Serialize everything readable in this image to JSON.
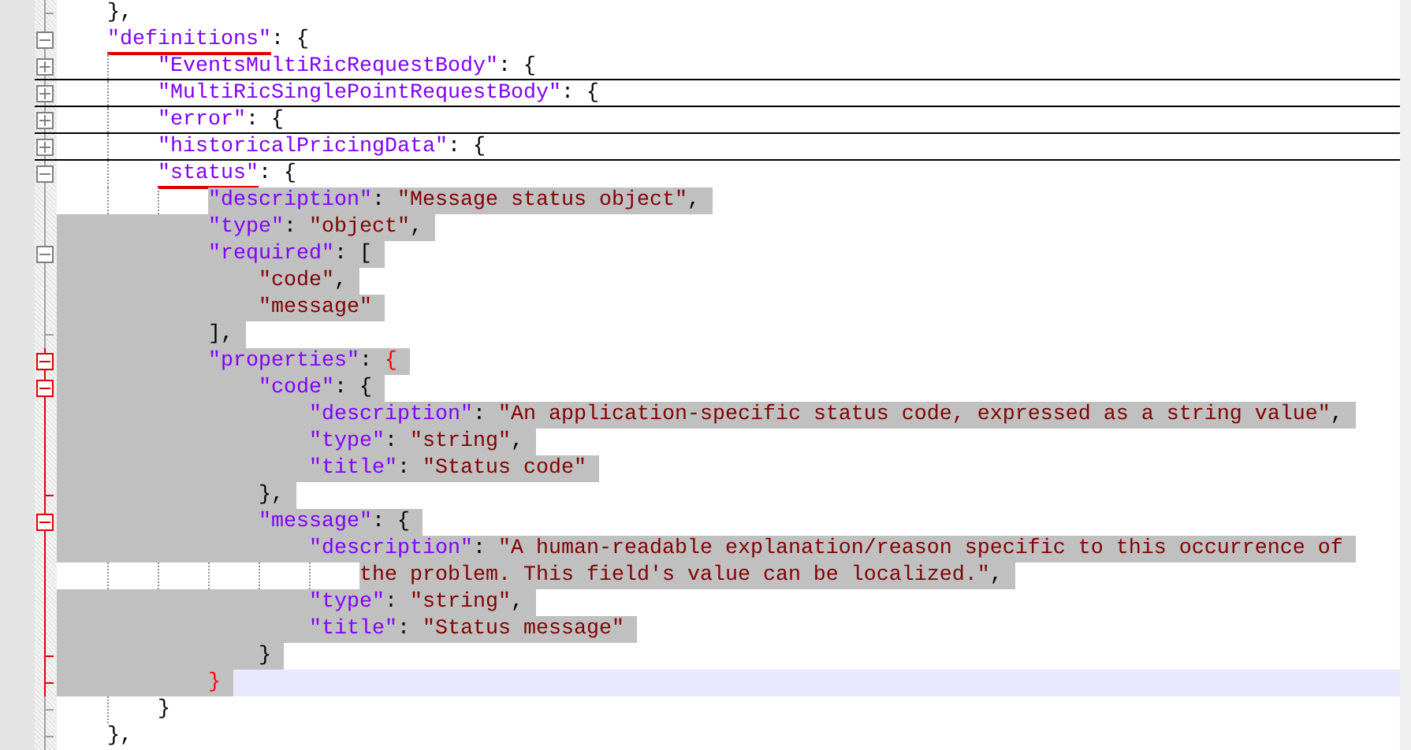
{
  "editor": {
    "lines": [
      {
        "kind": "close",
        "tokens": [
          {
            "kind": "punct",
            "text": "},"
          }
        ]
      },
      {
        "kind": "open",
        "expanded": true,
        "tokens": [
          {
            "kind": "key",
            "text": "\"definitions\"",
            "underlined": true
          },
          {
            "kind": "punct",
            "text": ": {"
          }
        ],
        "children": [
          {
            "kind": "open",
            "expanded": false,
            "tokens": [
              {
                "kind": "key",
                "text": "\"EventsMultiRicRequestBody\""
              },
              {
                "kind": "punct",
                "text": ": {"
              }
            ]
          },
          {
            "kind": "open",
            "expanded": false,
            "tokens": [
              {
                "kind": "key",
                "text": "\"MultiRicSinglePointRequestBody\""
              },
              {
                "kind": "punct",
                "text": ": {"
              }
            ]
          },
          {
            "kind": "open",
            "expanded": false,
            "tokens": [
              {
                "kind": "key",
                "text": "\"error\""
              },
              {
                "kind": "punct",
                "text": ": {"
              }
            ]
          },
          {
            "kind": "open",
            "expanded": false,
            "tokens": [
              {
                "kind": "key",
                "text": "\"historicalPricingData\""
              },
              {
                "kind": "punct",
                "text": ": {"
              }
            ]
          },
          {
            "kind": "open",
            "expanded": true,
            "tokens": [
              {
                "kind": "key",
                "text": "\"status\"",
                "underlined": true
              },
              {
                "kind": "punct",
                "text": ": {"
              }
            ],
            "children": [
              {
                "kind": "line",
                "selected": true,
                "tokens": [
                  {
                    "kind": "key",
                    "text": "\"description\""
                  },
                  {
                    "kind": "punct",
                    "text": ": "
                  },
                  {
                    "kind": "string",
                    "text": "\"Message status object\""
                  },
                  {
                    "kind": "punct",
                    "text": ","
                  }
                ]
              },
              {
                "kind": "line",
                "selected": true,
                "tokens": [
                  {
                    "kind": "key",
                    "text": "\"type\""
                  },
                  {
                    "kind": "punct",
                    "text": ": "
                  },
                  {
                    "kind": "string",
                    "text": "\"object\""
                  },
                  {
                    "kind": "punct",
                    "text": ","
                  }
                ]
              },
              {
                "kind": "open",
                "expanded": true,
                "selected": true,
                "tokens": [
                  {
                    "kind": "key",
                    "text": "\"required\""
                  },
                  {
                    "kind": "punct",
                    "text": ": ["
                  }
                ],
                "children": [
                  {
                    "kind": "line",
                    "selected": true,
                    "tokens": [
                      {
                        "kind": "string",
                        "text": "\"code\""
                      },
                      {
                        "kind": "punct",
                        "text": ","
                      }
                    ]
                  },
                  {
                    "kind": "line",
                    "selected": true,
                    "tokens": [
                      {
                        "kind": "string",
                        "text": "\"message\""
                      }
                    ]
                  }
                ]
              },
              {
                "kind": "close",
                "selected": true,
                "tokens": [
                  {
                    "kind": "punct",
                    "text": "],"
                  }
                ]
              },
              {
                "kind": "open",
                "expanded": true,
                "highlighted": true,
                "selected": true,
                "tokens": [
                  {
                    "kind": "key",
                    "text": "\"properties\""
                  },
                  {
                    "kind": "punct",
                    "text": ": "
                  },
                  {
                    "kind": "brace-match",
                    "text": "{"
                  }
                ],
                "children": [
                  {
                    "kind": "open",
                    "expanded": true,
                    "selected": true,
                    "tokens": [
                      {
                        "kind": "key",
                        "text": "\"code\""
                      },
                      {
                        "kind": "punct",
                        "text": ": {"
                      }
                    ],
                    "children": [
                      {
                        "kind": "line",
                        "selected": true,
                        "tokens": [
                          {
                            "kind": "key",
                            "text": "\"description\""
                          },
                          {
                            "kind": "punct",
                            "text": ": "
                          },
                          {
                            "kind": "string",
                            "text": "\"An application-specific status code, expressed as a string value\""
                          },
                          {
                            "kind": "punct",
                            "text": ","
                          }
                        ]
                      },
                      {
                        "kind": "line",
                        "selected": true,
                        "tokens": [
                          {
                            "kind": "key",
                            "text": "\"type\""
                          },
                          {
                            "kind": "punct",
                            "text": ": "
                          },
                          {
                            "kind": "string",
                            "text": "\"string\""
                          },
                          {
                            "kind": "punct",
                            "text": ","
                          }
                        ]
                      },
                      {
                        "kind": "line",
                        "selected": true,
                        "tokens": [
                          {
                            "kind": "key",
                            "text": "\"title\""
                          },
                          {
                            "kind": "punct",
                            "text": ": "
                          },
                          {
                            "kind": "string",
                            "text": "\"Status code\""
                          }
                        ]
                      }
                    ]
                  },
                  {
                    "kind": "close",
                    "selected": true,
                    "tokens": [
                      {
                        "kind": "punct",
                        "text": "},"
                      }
                    ]
                  },
                  {
                    "kind": "open",
                    "expanded": true,
                    "selected": true,
                    "tokens": [
                      {
                        "kind": "key",
                        "text": "\"message\""
                      },
                      {
                        "kind": "punct",
                        "text": ": {"
                      }
                    ],
                    "children": [
                      {
                        "kind": "line",
                        "selected": true,
                        "tokens": [
                          {
                            "kind": "key",
                            "text": "\"description\""
                          },
                          {
                            "kind": "punct",
                            "text": ": "
                          },
                          {
                            "kind": "string",
                            "text": "\"A human-readable explanation/reason specific to this occurrence of"
                          }
                        ],
                        "continuation": [
                          {
                            "kind": "string",
                            "text": "the problem. This field's value can be localized.\""
                          },
                          {
                            "kind": "punct",
                            "text": ","
                          }
                        ]
                      },
                      {
                        "kind": "line",
                        "selected": true,
                        "tokens": [
                          {
                            "kind": "key",
                            "text": "\"type\""
                          },
                          {
                            "kind": "punct",
                            "text": ": "
                          },
                          {
                            "kind": "string",
                            "text": "\"string\""
                          },
                          {
                            "kind": "punct",
                            "text": ","
                          }
                        ]
                      },
                      {
                        "kind": "line",
                        "selected": true,
                        "tokens": [
                          {
                            "kind": "key",
                            "text": "\"title\""
                          },
                          {
                            "kind": "punct",
                            "text": ": "
                          },
                          {
                            "kind": "string",
                            "text": "\"Status message\""
                          }
                        ]
                      }
                    ]
                  },
                  {
                    "kind": "close",
                    "selected": true,
                    "tokens": [
                      {
                        "kind": "punct",
                        "text": "}"
                      }
                    ]
                  }
                ]
              },
              {
                "kind": "close",
                "highlighted": true,
                "current": true,
                "selected": true,
                "tokens": [
                  {
                    "kind": "brace-match",
                    "text": "}"
                  }
                ]
              }
            ]
          },
          {
            "kind": "close",
            "tokens": [
              {
                "kind": "punct",
                "text": "}"
              }
            ]
          }
        ]
      },
      {
        "kind": "close",
        "tokens": [
          {
            "kind": "punct",
            "text": "},"
          }
        ]
      }
    ]
  }
}
